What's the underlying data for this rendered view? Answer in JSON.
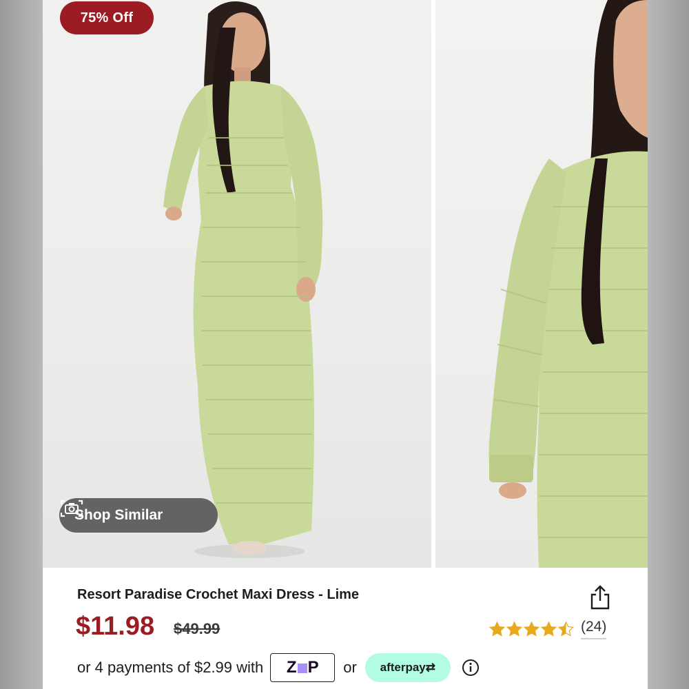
{
  "badge": {
    "discount": "75% Off"
  },
  "shop_similar": {
    "label": "Shop Similar",
    "icon": "camera-icon"
  },
  "product": {
    "title": "Resort Paradise Crochet Maxi Dress - Lime",
    "sale_price": "$11.98",
    "original_price": "$49.99",
    "rating": 4.5,
    "rating_max": 5,
    "review_count": "(24)"
  },
  "payments": {
    "text": "or 4 payments of $2.99 with",
    "zip_label": "zip",
    "or_label": "or",
    "afterpay_label": "afterpay",
    "info_icon": "info-icon"
  },
  "icons": {
    "share": "share-icon",
    "star": "star-icon"
  },
  "colors": {
    "discount_badge": "#9b1c23",
    "sale_price": "#9b1c23",
    "star": "#e8a91c",
    "afterpay": "#b2fce4",
    "zip_accent": "#aa8ff7",
    "dress": "#c9d99a"
  }
}
